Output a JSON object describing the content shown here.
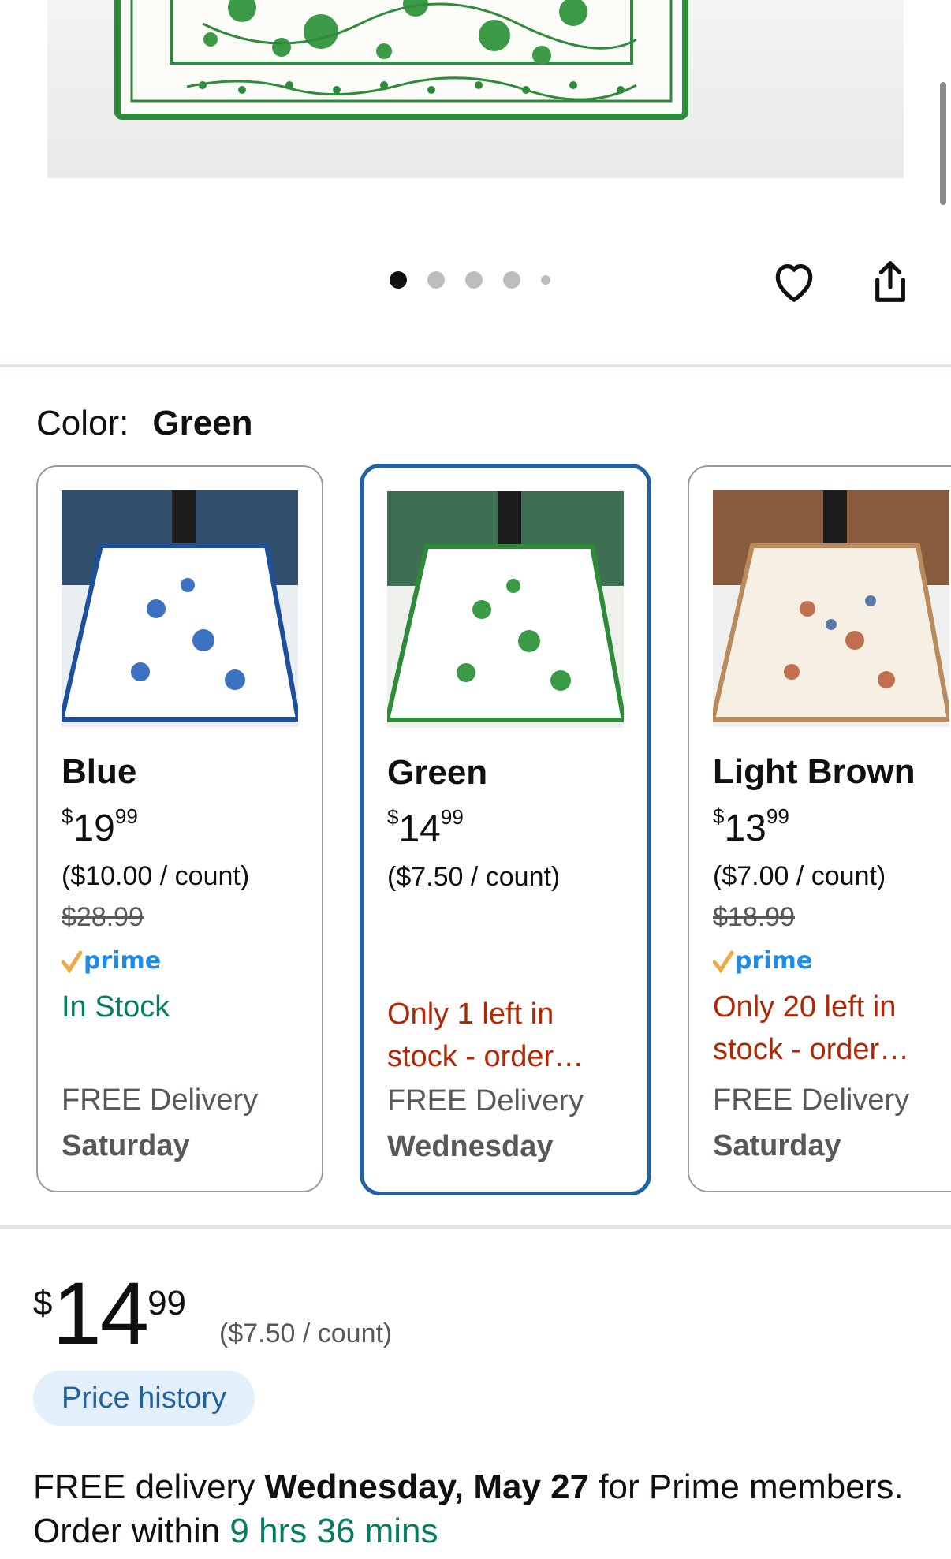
{
  "gallery": {
    "dots": [
      true,
      false,
      false,
      false,
      false
    ]
  },
  "color": {
    "label": "Color:",
    "selected": "Green"
  },
  "swatches": [
    {
      "name": "Blue",
      "price_symbol": "$",
      "price_whole": "19",
      "price_cents": "99",
      "unit_price": "($10.00 / count)",
      "list_price": "$28.99",
      "prime": "prime",
      "stock": "In Stock",
      "delivery": "FREE Delivery",
      "delivery_day": "Saturday",
      "accent": "#1e4f9c"
    },
    {
      "name": "Green",
      "price_symbol": "$",
      "price_whole": "14",
      "price_cents": "99",
      "unit_price": "($7.50 / count)",
      "stock": "Only 1 left in stock - order…",
      "delivery": "FREE Delivery",
      "delivery_day": "Wednesday",
      "accent": "#2e8b3a"
    },
    {
      "name": "Light Brown",
      "price_symbol": "$",
      "price_whole": "13",
      "price_cents": "99",
      "unit_price": "($7.00 / count)",
      "list_price": "$18.99",
      "prime": "prime",
      "stock": "Only 20 left in stock - order…",
      "delivery": "FREE Delivery",
      "delivery_day": "Saturday",
      "accent": "#b88a5c"
    }
  ],
  "price": {
    "symbol": "$",
    "whole": "14",
    "cents": "99",
    "unit": "($7.50 / count)"
  },
  "price_history_label": "Price history",
  "delivery": {
    "prefix": "FREE delivery",
    "date": "Wednesday, May 27",
    "middle": "for Prime members. Order within",
    "timer": "9 hrs 36 mins"
  },
  "colors": {
    "selected_border": "#2162a1",
    "in_stock": "#067d62",
    "low_stock": "#b12704",
    "prime_blue": "#1f8ce6"
  }
}
